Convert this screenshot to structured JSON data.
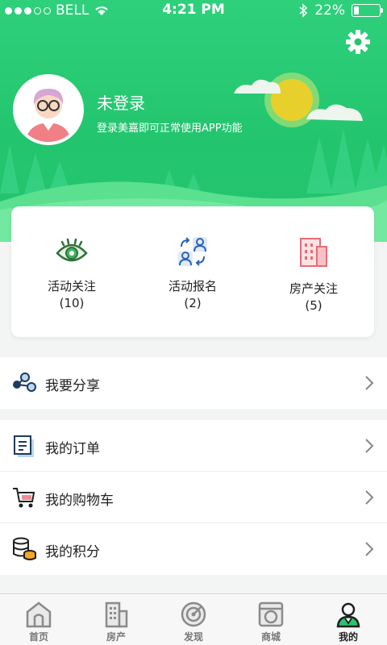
{
  "status_bar": {
    "carrier": "BELL",
    "time": "4:21 PM",
    "battery_percent": "22%",
    "battery_level": 0.22,
    "signal_bars_filled": 3,
    "signal_bars_total": 5
  },
  "header": {
    "settings_icon": "gear-icon",
    "user_name": "未登录",
    "user_subtitle": "登录美嘉即可正常使用APP功能",
    "accent_color": "#22c56d"
  },
  "stats": [
    {
      "label": "活动关注",
      "count": "(10)",
      "icon": "eye-icon"
    },
    {
      "label": "活动报名",
      "count": "(2)",
      "icon": "exchange-users-icon"
    },
    {
      "label": "房产关注",
      "count": "(5)",
      "icon": "building-icon"
    }
  ],
  "menu": {
    "group1": [
      {
        "label": "我要分享",
        "icon": "share-icon"
      }
    ],
    "group2": [
      {
        "label": "我的订单",
        "icon": "order-icon"
      },
      {
        "label": "我的购物车",
        "icon": "cart-icon"
      },
      {
        "label": "我的积分",
        "icon": "points-icon"
      }
    ]
  },
  "tabbar": [
    {
      "label": "首页",
      "icon": "home-icon",
      "active": false
    },
    {
      "label": "房产",
      "icon": "building-icon",
      "active": false
    },
    {
      "label": "发现",
      "icon": "radar-icon",
      "active": false
    },
    {
      "label": "商城",
      "icon": "washer-icon",
      "active": false
    },
    {
      "label": "我的",
      "icon": "user-icon",
      "active": true
    }
  ]
}
